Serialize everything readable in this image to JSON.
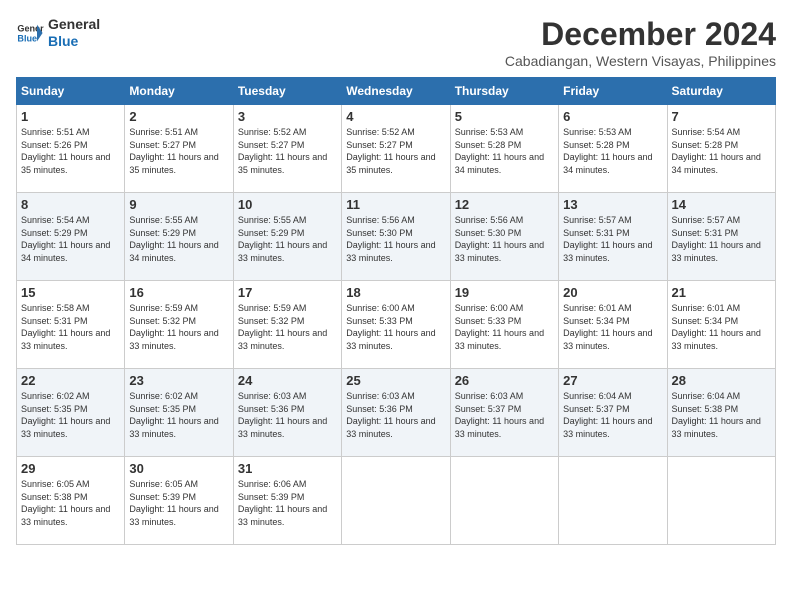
{
  "logo": {
    "line1": "General",
    "line2": "Blue"
  },
  "title": "December 2024",
  "location": "Cabadiangan, Western Visayas, Philippines",
  "headers": [
    "Sunday",
    "Monday",
    "Tuesday",
    "Wednesday",
    "Thursday",
    "Friday",
    "Saturday"
  ],
  "weeks": [
    [
      {
        "day": "1",
        "sunrise": "5:51 AM",
        "sunset": "5:26 PM",
        "daylight": "11 hours and 35 minutes."
      },
      {
        "day": "2",
        "sunrise": "5:51 AM",
        "sunset": "5:27 PM",
        "daylight": "11 hours and 35 minutes."
      },
      {
        "day": "3",
        "sunrise": "5:52 AM",
        "sunset": "5:27 PM",
        "daylight": "11 hours and 35 minutes."
      },
      {
        "day": "4",
        "sunrise": "5:52 AM",
        "sunset": "5:27 PM",
        "daylight": "11 hours and 35 minutes."
      },
      {
        "day": "5",
        "sunrise": "5:53 AM",
        "sunset": "5:28 PM",
        "daylight": "11 hours and 34 minutes."
      },
      {
        "day": "6",
        "sunrise": "5:53 AM",
        "sunset": "5:28 PM",
        "daylight": "11 hours and 34 minutes."
      },
      {
        "day": "7",
        "sunrise": "5:54 AM",
        "sunset": "5:28 PM",
        "daylight": "11 hours and 34 minutes."
      }
    ],
    [
      {
        "day": "8",
        "sunrise": "5:54 AM",
        "sunset": "5:29 PM",
        "daylight": "11 hours and 34 minutes."
      },
      {
        "day": "9",
        "sunrise": "5:55 AM",
        "sunset": "5:29 PM",
        "daylight": "11 hours and 34 minutes."
      },
      {
        "day": "10",
        "sunrise": "5:55 AM",
        "sunset": "5:29 PM",
        "daylight": "11 hours and 33 minutes."
      },
      {
        "day": "11",
        "sunrise": "5:56 AM",
        "sunset": "5:30 PM",
        "daylight": "11 hours and 33 minutes."
      },
      {
        "day": "12",
        "sunrise": "5:56 AM",
        "sunset": "5:30 PM",
        "daylight": "11 hours and 33 minutes."
      },
      {
        "day": "13",
        "sunrise": "5:57 AM",
        "sunset": "5:31 PM",
        "daylight": "11 hours and 33 minutes."
      },
      {
        "day": "14",
        "sunrise": "5:57 AM",
        "sunset": "5:31 PM",
        "daylight": "11 hours and 33 minutes."
      }
    ],
    [
      {
        "day": "15",
        "sunrise": "5:58 AM",
        "sunset": "5:31 PM",
        "daylight": "11 hours and 33 minutes."
      },
      {
        "day": "16",
        "sunrise": "5:59 AM",
        "sunset": "5:32 PM",
        "daylight": "11 hours and 33 minutes."
      },
      {
        "day": "17",
        "sunrise": "5:59 AM",
        "sunset": "5:32 PM",
        "daylight": "11 hours and 33 minutes."
      },
      {
        "day": "18",
        "sunrise": "6:00 AM",
        "sunset": "5:33 PM",
        "daylight": "11 hours and 33 minutes."
      },
      {
        "day": "19",
        "sunrise": "6:00 AM",
        "sunset": "5:33 PM",
        "daylight": "11 hours and 33 minutes."
      },
      {
        "day": "20",
        "sunrise": "6:01 AM",
        "sunset": "5:34 PM",
        "daylight": "11 hours and 33 minutes."
      },
      {
        "day": "21",
        "sunrise": "6:01 AM",
        "sunset": "5:34 PM",
        "daylight": "11 hours and 33 minutes."
      }
    ],
    [
      {
        "day": "22",
        "sunrise": "6:02 AM",
        "sunset": "5:35 PM",
        "daylight": "11 hours and 33 minutes."
      },
      {
        "day": "23",
        "sunrise": "6:02 AM",
        "sunset": "5:35 PM",
        "daylight": "11 hours and 33 minutes."
      },
      {
        "day": "24",
        "sunrise": "6:03 AM",
        "sunset": "5:36 PM",
        "daylight": "11 hours and 33 minutes."
      },
      {
        "day": "25",
        "sunrise": "6:03 AM",
        "sunset": "5:36 PM",
        "daylight": "11 hours and 33 minutes."
      },
      {
        "day": "26",
        "sunrise": "6:03 AM",
        "sunset": "5:37 PM",
        "daylight": "11 hours and 33 minutes."
      },
      {
        "day": "27",
        "sunrise": "6:04 AM",
        "sunset": "5:37 PM",
        "daylight": "11 hours and 33 minutes."
      },
      {
        "day": "28",
        "sunrise": "6:04 AM",
        "sunset": "5:38 PM",
        "daylight": "11 hours and 33 minutes."
      }
    ],
    [
      {
        "day": "29",
        "sunrise": "6:05 AM",
        "sunset": "5:38 PM",
        "daylight": "11 hours and 33 minutes."
      },
      {
        "day": "30",
        "sunrise": "6:05 AM",
        "sunset": "5:39 PM",
        "daylight": "11 hours and 33 minutes."
      },
      {
        "day": "31",
        "sunrise": "6:06 AM",
        "sunset": "5:39 PM",
        "daylight": "11 hours and 33 minutes."
      },
      null,
      null,
      null,
      null
    ]
  ]
}
